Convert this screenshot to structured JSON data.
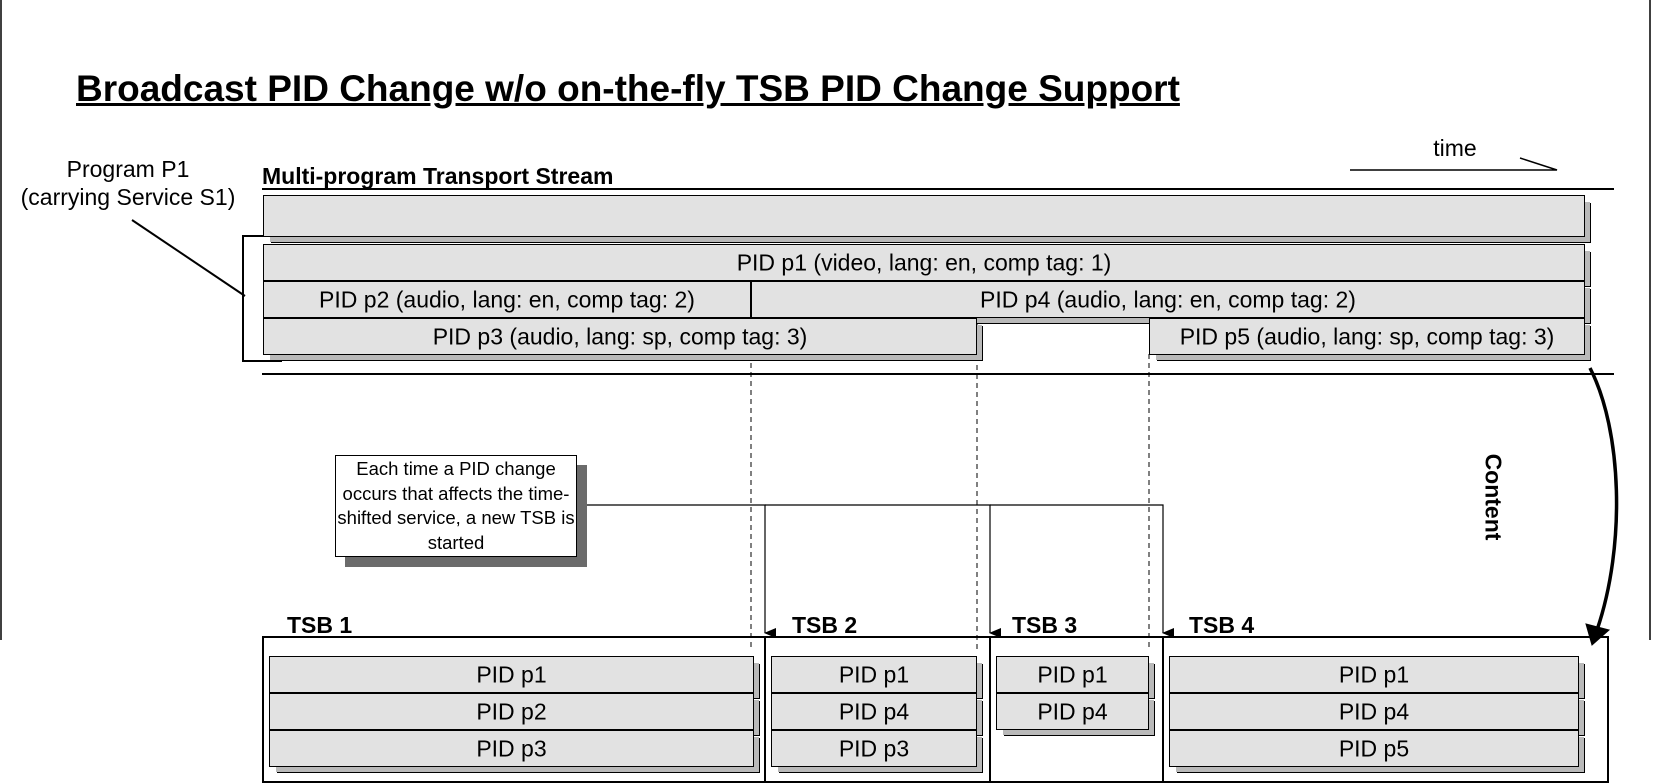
{
  "title": "Broadcast PID Change w/o on-the-fly TSB PID Change Support",
  "subtitle": "Multi-program Transport Stream",
  "time_label": "time",
  "program_callout": {
    "line1": "Program P1",
    "line2": "(carrying Service S1)"
  },
  "stream_bars": {
    "p1": "PID p1 (video, lang: en, comp tag: 1)",
    "p2": "PID p2 (audio, lang: en, comp tag: 2)",
    "p4": "PID p4 (audio, lang: en, comp tag: 2)",
    "p3": "PID p3 (audio, lang: sp, comp tag: 3)",
    "p5": "PID p5 (audio, lang: sp, comp tag: 3)"
  },
  "content_label": "Content",
  "note": "Each time a PID change occurs that affects the time-shifted service, a new TSB is started",
  "tsbs": [
    {
      "label": "TSB 1",
      "pids": [
        "PID p1",
        "PID p2",
        "PID p3"
      ]
    },
    {
      "label": "TSB 2",
      "pids": [
        "PID p1",
        "PID p4",
        "PID p3"
      ]
    },
    {
      "label": "TSB 3",
      "pids": [
        "PID p1",
        "PID p4"
      ]
    },
    {
      "label": "TSB 4",
      "pids": [
        "PID p1",
        "PID p4",
        "PID p5"
      ]
    }
  ]
}
